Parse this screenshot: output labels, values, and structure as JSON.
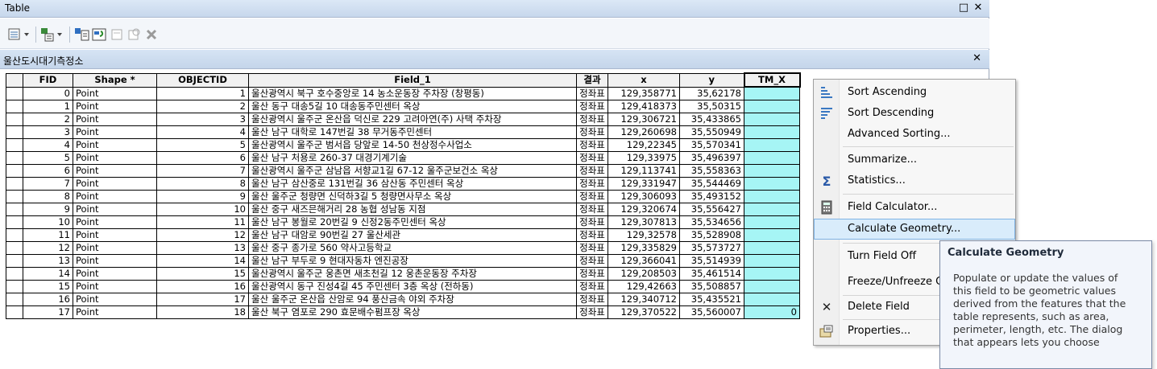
{
  "window": {
    "title": "Table",
    "restore_icon": "restore-icon",
    "close_icon": "close-icon"
  },
  "toolbar": {
    "buttons": [
      "table-options-icon",
      "related-tables-icon",
      "select-by-attributes-icon",
      "switch-selection-icon",
      "clear-selection-icon",
      "zoom-to-selected-icon",
      "delete-selected-icon"
    ]
  },
  "tab": {
    "label": "울산도시대기측정소"
  },
  "columns": [
    "FID",
    "Shape *",
    "OBJECTID",
    "Field_1",
    "결과",
    "x",
    "y",
    "TM_X"
  ],
  "rows": [
    [
      "0",
      "Point",
      "1",
      "울산광역시 북구 호수중앙로 14 농소운동장 주차장 (창평동)",
      "정좌표",
      "129,358771",
      "35,62178",
      ""
    ],
    [
      "1",
      "Point",
      "2",
      "울산 동구 대송5길 10 대송동주민센터 옥상",
      "정좌표",
      "129,418373",
      "35,50315",
      ""
    ],
    [
      "2",
      "Point",
      "3",
      "울산광역시 울주군 온산읍 덕신로 229 고려아연(주) 사택 주차장",
      "정좌표",
      "129,306721",
      "35,433865",
      ""
    ],
    [
      "3",
      "Point",
      "4",
      "울산 남구 대학로 147번길 38 무거동주민센터",
      "정좌표",
      "129,260698",
      "35,550949",
      ""
    ],
    [
      "4",
      "Point",
      "5",
      "울산광역시 울주군 범서읍 당앞로 14-50 천상정수사업소",
      "정좌표",
      "129,22345",
      "35,570341",
      ""
    ],
    [
      "5",
      "Point",
      "6",
      "울산 남구 처용로 260-37 대경기계기술",
      "정좌표",
      "129,33975",
      "35,496397",
      ""
    ],
    [
      "6",
      "Point",
      "7",
      "울산광역시 울주군 삼남읍 서향교1길 67-12 울주군보건소 옥상",
      "정좌표",
      "129,113741",
      "35,558363",
      ""
    ],
    [
      "7",
      "Point",
      "8",
      "울산 남구 삼산중로 131번길 36 삼산동 주민센터 옥상",
      "정좌표",
      "129,331947",
      "35,544469",
      ""
    ],
    [
      "8",
      "Point",
      "9",
      "울산 울주군 청량면 신덕하3길 5 청량면사무소 옥상",
      "정좌표",
      "129,306093",
      "35,493152",
      ""
    ],
    [
      "9",
      "Point",
      "10",
      "울산 중구 새즈믄해거리 28 농협 성남동 지점",
      "정좌표",
      "129,320674",
      "35,556427",
      ""
    ],
    [
      "10",
      "Point",
      "11",
      "울산 남구 봉월로 20번길 9 신정2동주민센터 옥상",
      "정좌표",
      "129,307813",
      "35,534656",
      ""
    ],
    [
      "11",
      "Point",
      "12",
      "울산 남구 대암로 90번길 27 울산세관",
      "정좌표",
      "129,32578",
      "35,528908",
      ""
    ],
    [
      "12",
      "Point",
      "13",
      "울산 중구 종가로 560 약사고등학교",
      "정좌표",
      "129,335829",
      "35,573727",
      ""
    ],
    [
      "13",
      "Point",
      "14",
      "울산 남구 부두로 9 현대자동차 엔진공장",
      "정좌표",
      "129,366041",
      "35,514939",
      ""
    ],
    [
      "14",
      "Point",
      "15",
      "울산광역시 울주군 웅촌면 새초천길 12 웅촌운동장 주차장",
      "정좌표",
      "129,208503",
      "35,461514",
      ""
    ],
    [
      "15",
      "Point",
      "16",
      "울산광역시 동구 진성4길 45 주민센터 3층 옥상 (전하동)",
      "정좌표",
      "129,42663",
      "35,508857",
      ""
    ],
    [
      "16",
      "Point",
      "17",
      "울산 울주군 온산읍 산암로 94 풍산금속 야외 주차장",
      "정좌표",
      "129,340712",
      "35,435521",
      ""
    ],
    [
      "17",
      "Point",
      "18",
      "울산 북구 염포로 290 효문배수펌프장 옥상",
      "정좌표",
      "129,370522",
      "35,560007",
      "0"
    ]
  ],
  "context_menu": {
    "items": [
      {
        "icon": "sort-ascending-icon",
        "label": "Sort Ascending"
      },
      {
        "icon": "sort-descending-icon",
        "label": "Sort Descending"
      },
      {
        "icon": "",
        "label": "Advanced Sorting..."
      },
      {
        "icon": "",
        "label": "Summarize..."
      },
      {
        "icon": "sigma-statistics-icon",
        "label": "Statistics..."
      },
      {
        "icon": "calculator-icon",
        "label": "Field Calculator..."
      },
      {
        "icon": "",
        "label": "Calculate Geometry..."
      },
      {
        "icon": "",
        "label": "Turn Field Off"
      },
      {
        "icon": "",
        "label": "Freeze/Unfreeze C"
      },
      {
        "icon": "delete-x-icon",
        "label": "Delete Field"
      },
      {
        "icon": "properties-icon",
        "label": "Properties..."
      }
    ],
    "highlighted": "Calculate Geometry..."
  },
  "tooltip": {
    "title": "Calculate Geometry",
    "body_lines": [
      "Populate or update the values of",
      "this field to be geometric values",
      "derived from the features that the",
      "table represents, such as area,",
      "perimeter, length, etc. The dialog",
      "that appears lets you choose"
    ]
  },
  "colors": {
    "tm_x_fill": "#a6f5f5",
    "menu_highlight": "#d9ecfb",
    "title_gradient": "#c7d7ec"
  }
}
